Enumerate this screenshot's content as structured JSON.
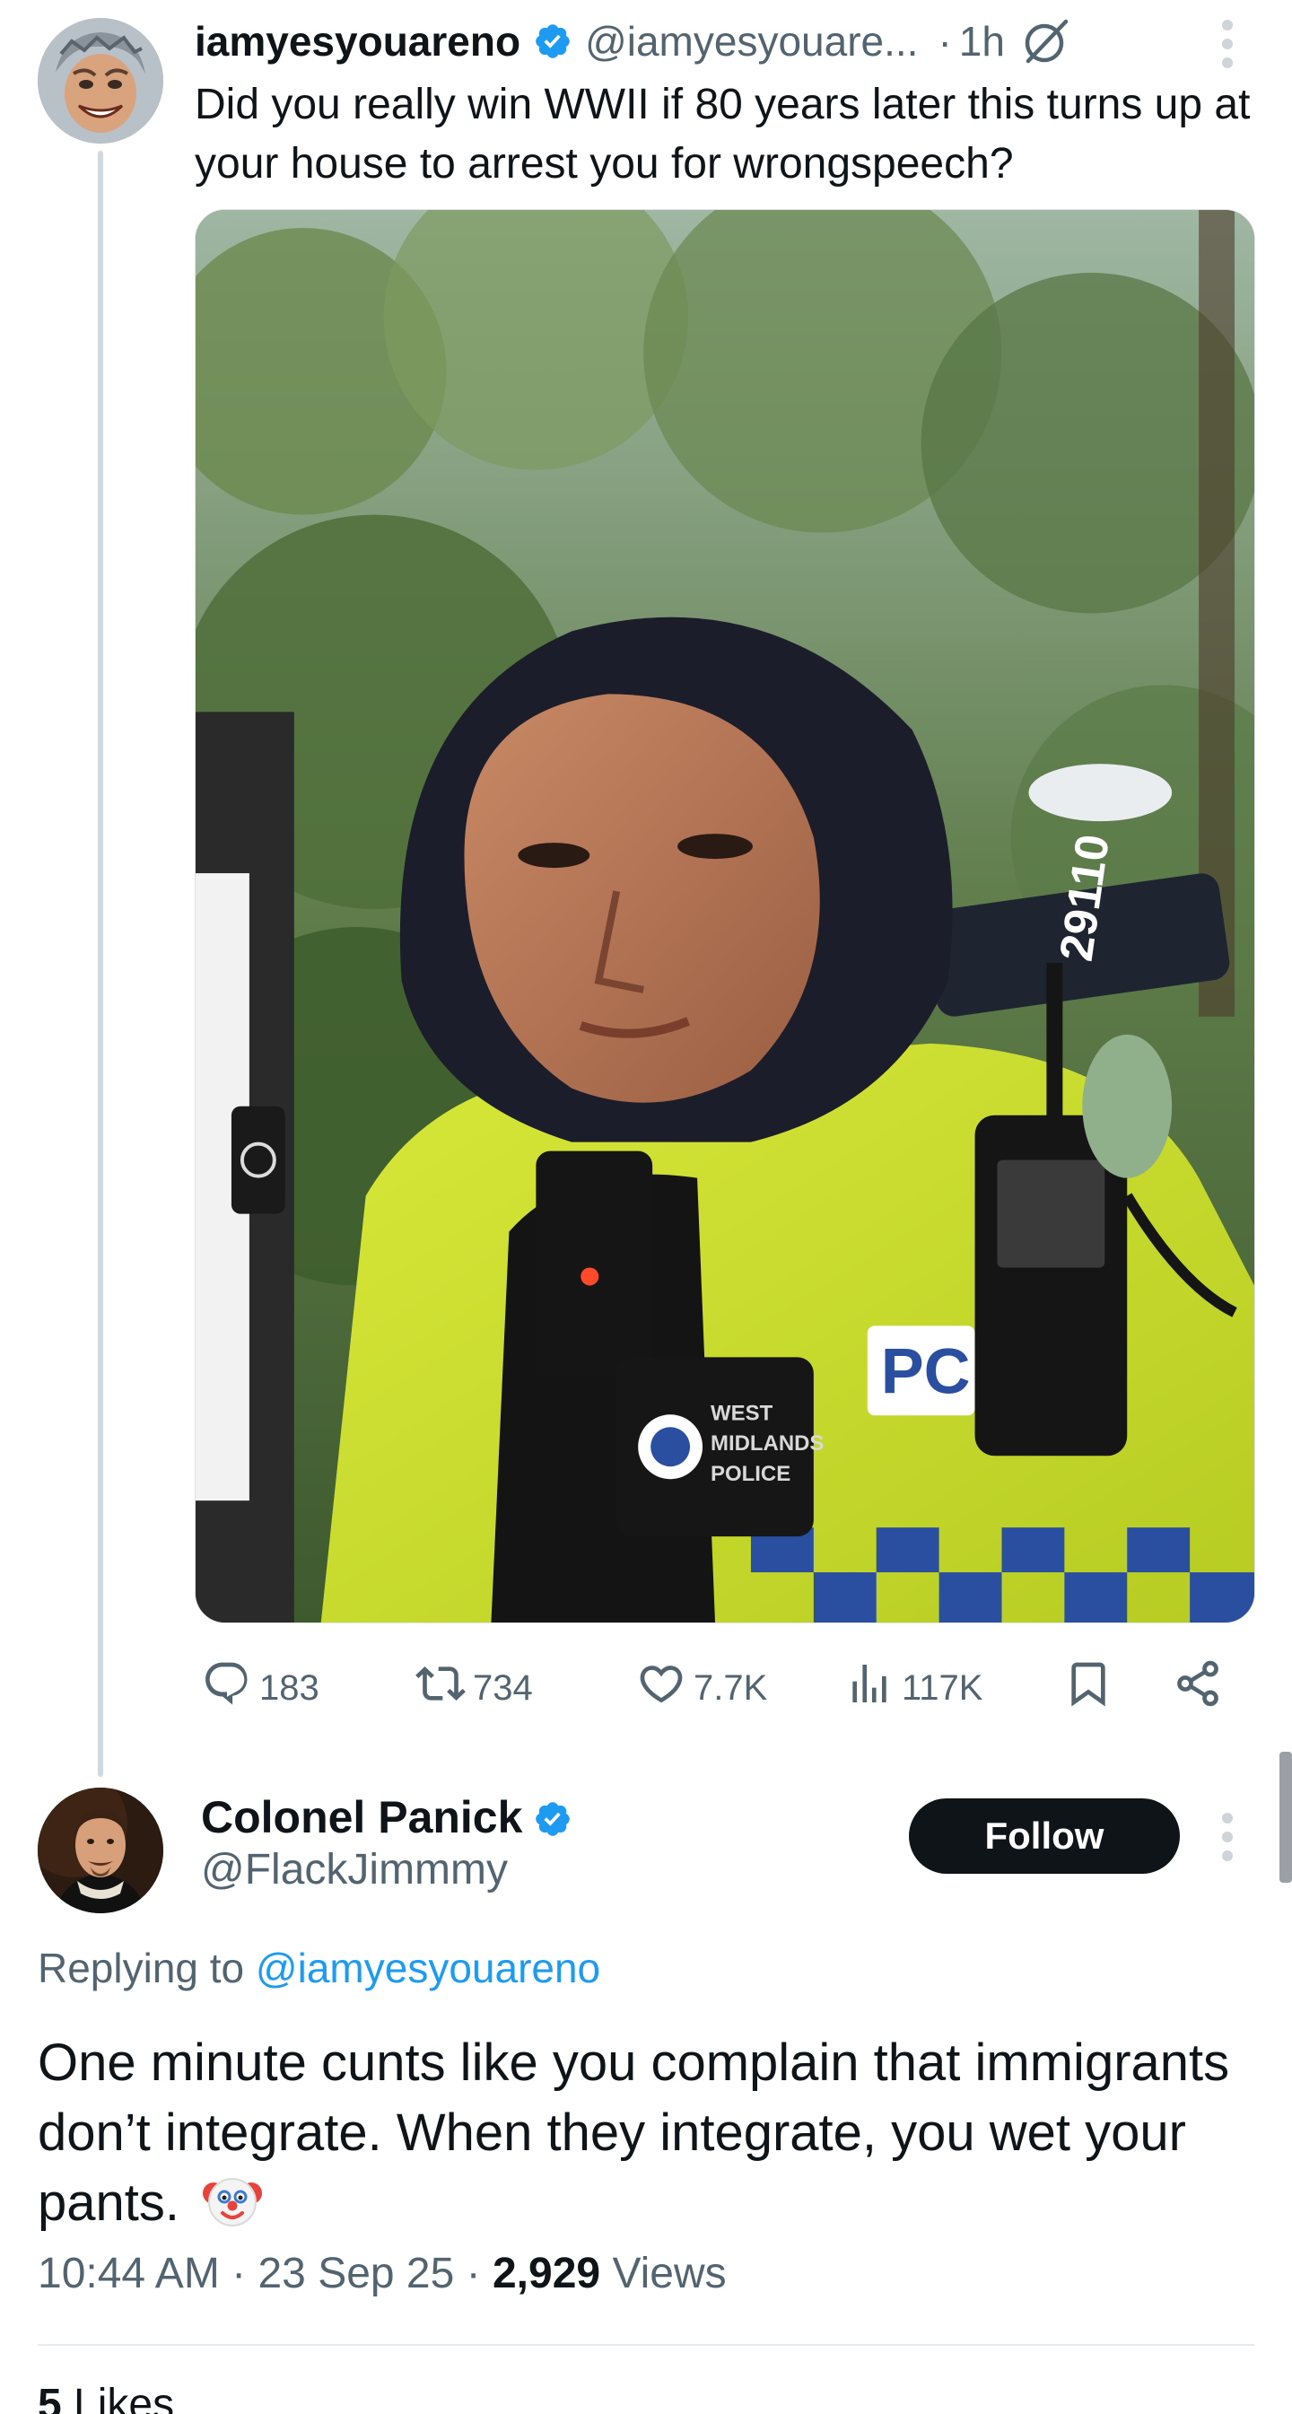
{
  "colors": {
    "accent": "#1d9bf0",
    "text": "#0f1419",
    "muted": "#536471",
    "follow_bg": "#0f1419"
  },
  "tweet": {
    "author": {
      "display_name": "iamyesyouareno",
      "handle": "@iamyesyouare...",
      "verified": true
    },
    "time": "1h",
    "dot": "·",
    "text": "Did you really win WWII if 80 years later this turns up at your house to arrest you for wrongspeech?",
    "media": {
      "type": "photo",
      "badge_number": "29110",
      "patch_text": [
        "WEST",
        "MIDLANDS",
        "POLICE"
      ],
      "vest_text": "PC"
    },
    "actions": {
      "replies": "183",
      "reposts": "734",
      "likes": "7.7K",
      "views": "117K"
    },
    "icons": [
      "grok-icon",
      "more-icon",
      "reply-icon",
      "repost-icon",
      "like-icon",
      "views-icon",
      "bookmark-icon",
      "share-icon"
    ]
  },
  "reply": {
    "author": {
      "display_name": "Colonel Panick",
      "handle": "@FlackJimmmy",
      "verified": true
    },
    "follow_label": "Follow",
    "replying_prefix": "Replying to ",
    "replying_to": "@iamyesyouareno",
    "text": "One minute cunts like you complain that immigrants don’t integrate. When they integrate, you wet your pants.",
    "emoji": "clown-face",
    "timestamp": "10:44 AM · 23 Sep 25 · ",
    "views_count": "2,929",
    "views_label": " Views",
    "likes_count": "5",
    "likes_label": " Likes"
  }
}
